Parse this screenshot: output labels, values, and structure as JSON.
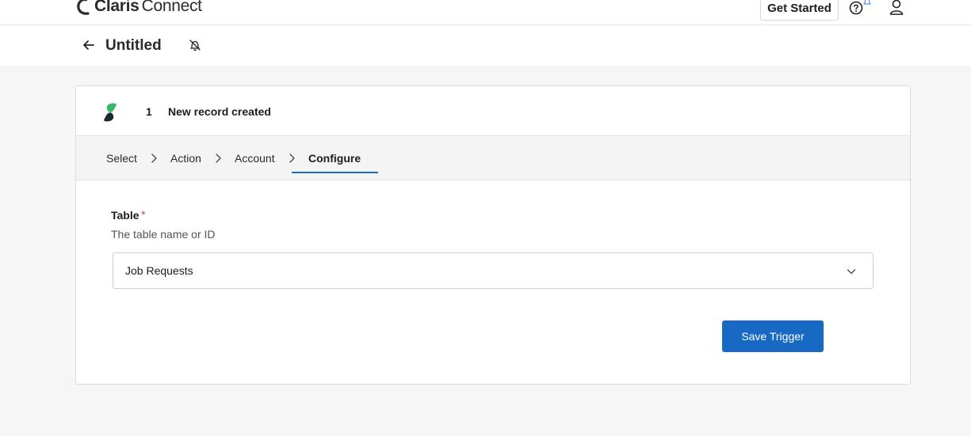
{
  "brand": {
    "name_bold": "Claris",
    "name_light": "Connect",
    "icon": "claris-logo-icon"
  },
  "topbar": {
    "get_started_label": "Get Started",
    "help_icon": "help-circle-icon",
    "notification_icon": "bell-icon",
    "user_icon": "user-icon"
  },
  "flow": {
    "title": "Untitled",
    "back_icon": "arrow-left-icon",
    "notify_icon": "bell-off-icon"
  },
  "trigger": {
    "step_number": "1",
    "step_title": "New record created",
    "app_icon": "app-logo-icon"
  },
  "steps": [
    {
      "label": "Select"
    },
    {
      "label": "Action"
    },
    {
      "label": "Account"
    },
    {
      "label": "Configure"
    }
  ],
  "active_step": "Configure",
  "form": {
    "table_label": "Table",
    "required_marker": "*",
    "table_help": "The table name or ID",
    "table_value": "Job Requests",
    "save_label": "Save Trigger"
  },
  "colors": {
    "accent": "#1769c4",
    "required": "#e0413b",
    "page_bg": "#f6f6f6"
  }
}
